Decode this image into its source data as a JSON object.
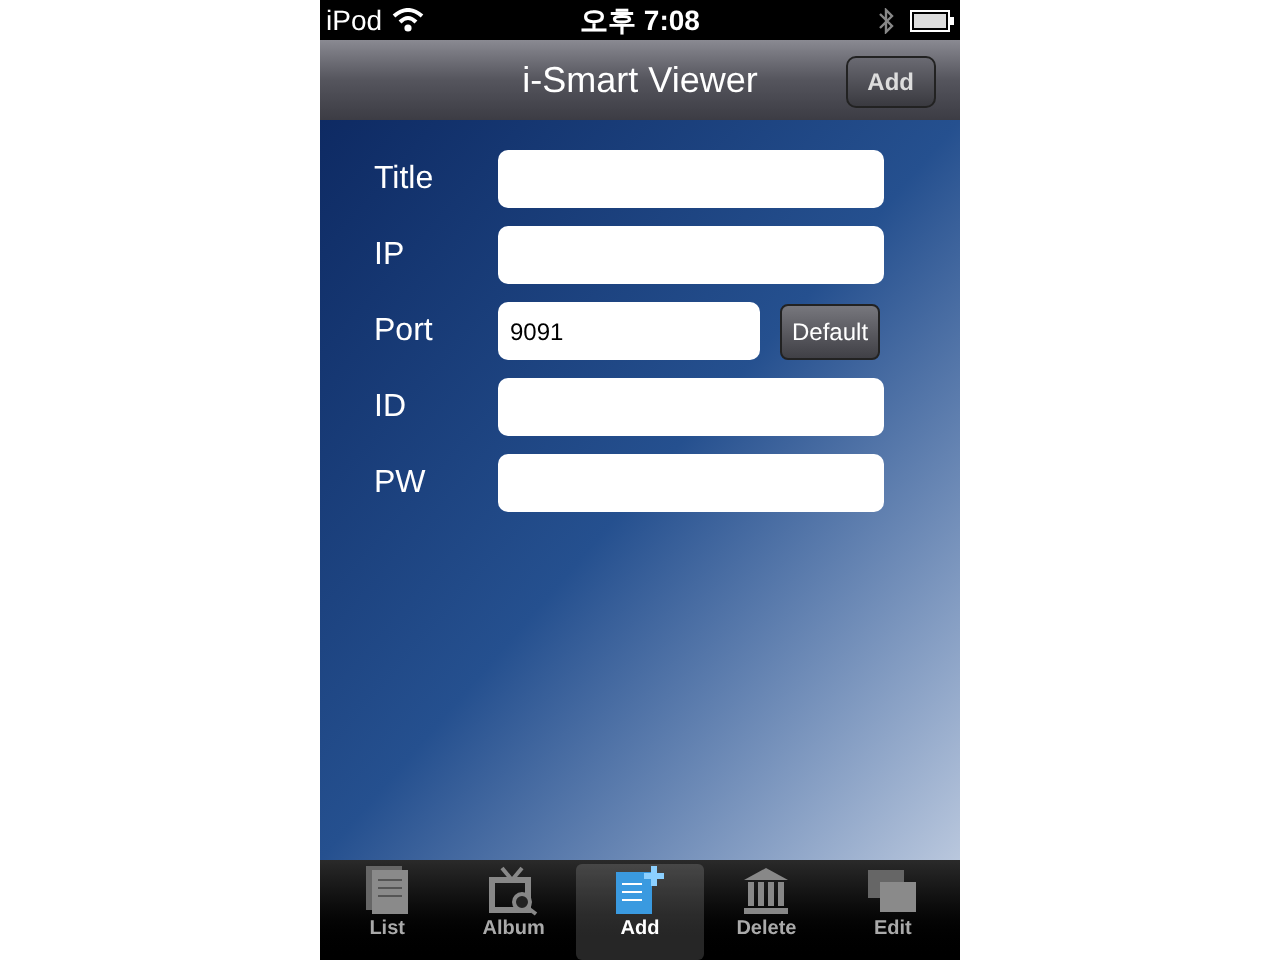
{
  "status_bar": {
    "carrier": "iPod",
    "time": "오후 7:08"
  },
  "nav_bar": {
    "title": "i-Smart Viewer",
    "button": "Add"
  },
  "form": [
    {
      "kind": "text",
      "label": "Title"
    },
    {
      "kind": "text",
      "label": "IP"
    },
    {
      "kind": "with_button",
      "label": "Port",
      "value": "9091",
      "button": "Default"
    },
    {
      "kind": "text",
      "label": "ID"
    },
    {
      "kind": "text",
      "label": "PW"
    }
  ],
  "tab_bar": [
    {
      "label": "List",
      "selected": false
    },
    {
      "label": "Album",
      "selected": false
    },
    {
      "label": "Add",
      "selected": true
    },
    {
      "label": "Delete",
      "selected": false
    },
    {
      "label": "Edit",
      "selected": false
    }
  ]
}
